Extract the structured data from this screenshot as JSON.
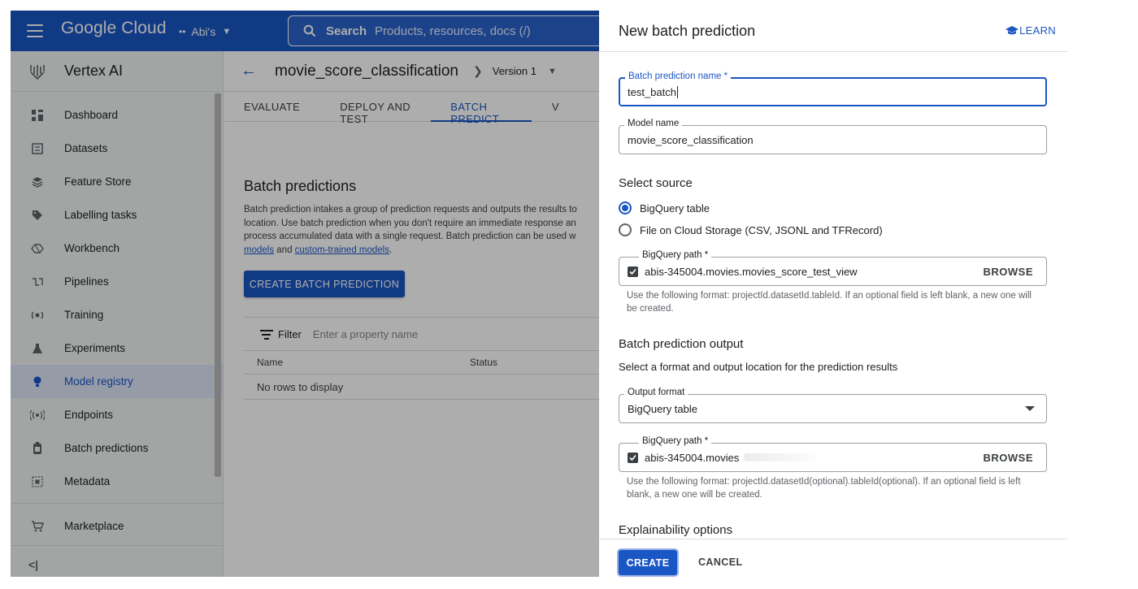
{
  "topbar": {
    "brand": "Google Cloud",
    "project": "Abi's",
    "search_label": "Search",
    "search_placeholder": "Products, resources, docs (/)"
  },
  "sidebar": {
    "title": "Vertex AI",
    "items": [
      {
        "label": "Dashboard",
        "icon": "dashboard-icon"
      },
      {
        "label": "Datasets",
        "icon": "datasets-icon"
      },
      {
        "label": "Feature Store",
        "icon": "feature-store-icon"
      },
      {
        "label": "Labelling tasks",
        "icon": "label-icon"
      },
      {
        "label": "Workbench",
        "icon": "workbench-icon"
      },
      {
        "label": "Pipelines",
        "icon": "pipelines-icon"
      },
      {
        "label": "Training",
        "icon": "training-icon"
      },
      {
        "label": "Experiments",
        "icon": "flask-icon"
      },
      {
        "label": "Model registry",
        "icon": "bulb-icon"
      },
      {
        "label": "Endpoints",
        "icon": "endpoint-icon"
      },
      {
        "label": "Batch predictions",
        "icon": "batch-icon"
      },
      {
        "label": "Metadata",
        "icon": "metadata-icon"
      }
    ],
    "marketplace": "Marketplace",
    "collapse": "<|"
  },
  "main": {
    "model_title": "movie_score_classification",
    "version": "Version 1",
    "tabs": [
      "EVALUATE",
      "DEPLOY AND TEST",
      "BATCH PREDICT",
      "V"
    ],
    "heading": "Batch predictions",
    "desc_line1": "Batch prediction intakes a group of prediction requests and outputs the results to",
    "desc_line2": "location. Use batch prediction when you don't require an immediate response an",
    "desc_line3": "process accumulated data with a single request. Batch prediction can be used w",
    "desc_link1": "models",
    "desc_and": " and ",
    "desc_link2": "custom-trained models",
    "desc_end": ".",
    "create_button": "CREATE BATCH PREDICTION",
    "filter_label": "Filter",
    "filter_placeholder": "Enter a property name",
    "columns": [
      "Name",
      "Status"
    ],
    "empty": "No rows to display"
  },
  "panel": {
    "title": "New batch prediction",
    "learn": "LEARN",
    "name_label": "Batch prediction name *",
    "name_value": "test_batch",
    "model_label": "Model name",
    "model_value": "movie_score_classification",
    "source_title": "Select source",
    "source_options": [
      "BigQuery table",
      "File on Cloud Storage (CSV, JSONL and TFRecord)"
    ],
    "source_selected": "BigQuery table",
    "bq_label": "BigQuery path *",
    "bq_value": "abis-345004.movies.movies_score_test_view",
    "browse": "BROWSE",
    "bq_help": "Use the following format: projectId.datasetId.tableId. If an optional field is left blank, a new one will be created.",
    "output_title": "Batch prediction output",
    "output_desc": "Select a format and output location for the prediction results",
    "format_label": "Output format",
    "format_value": "BigQuery table",
    "out_bq_label": "BigQuery path *",
    "out_bq_value": "abis-345004.movies",
    "out_help": "Use the following format: projectId.datasetId(optional).tableId(optional). If an optional field is left blank, a new one will be created.",
    "explain_title": "Explainability options",
    "create": "CREATE",
    "cancel": "CANCEL"
  },
  "colors": {
    "brand_blue": "#1a56c4",
    "sidebar_bg": "#f1f3f4",
    "active_bg": "#dde6f7"
  }
}
